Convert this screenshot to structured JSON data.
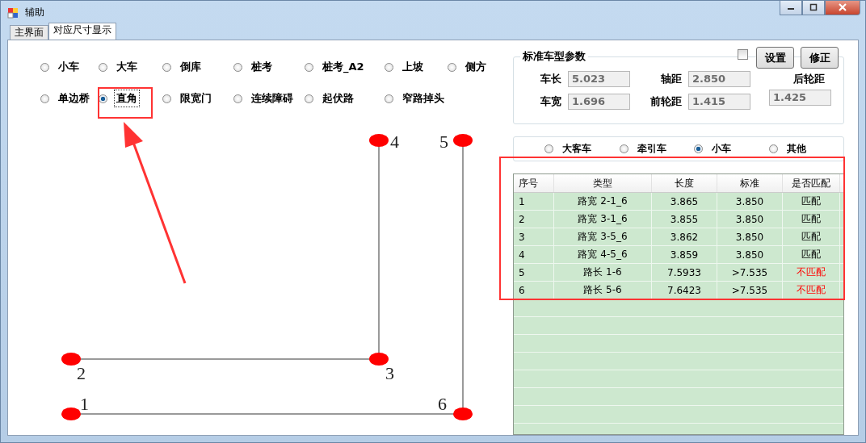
{
  "window": {
    "title": "辅助"
  },
  "tabs": [
    {
      "label": "主界面",
      "selected": false
    },
    {
      "label": "对应尺寸显示",
      "selected": true
    }
  ],
  "modes": [
    {
      "label": "小车",
      "selected": false
    },
    {
      "label": "大车",
      "selected": false
    },
    {
      "label": "倒库",
      "selected": false
    },
    {
      "label": "桩考",
      "selected": false
    },
    {
      "label": "桩考_A2",
      "selected": false
    },
    {
      "label": "上坡",
      "selected": false
    },
    {
      "label": "侧方",
      "selected": false
    },
    {
      "label": "单边桥",
      "selected": false
    },
    {
      "label": "直角",
      "selected": true
    },
    {
      "label": "限宽门",
      "selected": false
    },
    {
      "label": "连续障碍",
      "selected": false
    },
    {
      "label": "起伏路",
      "selected": false
    },
    {
      "label": "窄路掉头",
      "selected": false
    }
  ],
  "diagram": {
    "points": [
      {
        "label": "1"
      },
      {
        "label": "2"
      },
      {
        "label": "3"
      },
      {
        "label": "4"
      },
      {
        "label": "5"
      },
      {
        "label": "6"
      }
    ]
  },
  "standard_params": {
    "title": "标准车型参数",
    "checked": false,
    "buttons": [
      "设置",
      "修正"
    ],
    "fields": [
      {
        "label": "车长",
        "value": "5.023"
      },
      {
        "label": "轴距",
        "value": "2.850"
      },
      {
        "label": "后轮距",
        "value": "1.425"
      },
      {
        "label": "车宽",
        "value": "1.696"
      },
      {
        "label": "前轮距",
        "value": "1.415"
      }
    ]
  },
  "vehicle_types": [
    {
      "label": "大客车",
      "selected": false
    },
    {
      "label": "牵引车",
      "selected": false
    },
    {
      "label": "小车",
      "selected": true
    },
    {
      "label": "其他",
      "selected": false
    }
  ],
  "table": {
    "columns": [
      "序号",
      "类型",
      "长度",
      "标准",
      "是否匹配"
    ],
    "rows": [
      {
        "cells": [
          "1",
          "路宽 2-1_6",
          "3.865",
          "3.850",
          "匹配"
        ],
        "matched": true
      },
      {
        "cells": [
          "2",
          "路宽 3-1_6",
          "3.855",
          "3.850",
          "匹配"
        ],
        "matched": true
      },
      {
        "cells": [
          "3",
          "路宽 3-5_6",
          "3.862",
          "3.850",
          "匹配"
        ],
        "matched": true
      },
      {
        "cells": [
          "4",
          "路宽 4-5_6",
          "3.859",
          "3.850",
          "匹配"
        ],
        "matched": true
      },
      {
        "cells": [
          "5",
          "路长 1-6",
          "7.5933",
          ">7.535",
          "不匹配"
        ],
        "matched": false
      },
      {
        "cells": [
          "6",
          "路长 5-6",
          "7.6423",
          ">7.535",
          "不匹配"
        ],
        "matched": false
      }
    ]
  }
}
